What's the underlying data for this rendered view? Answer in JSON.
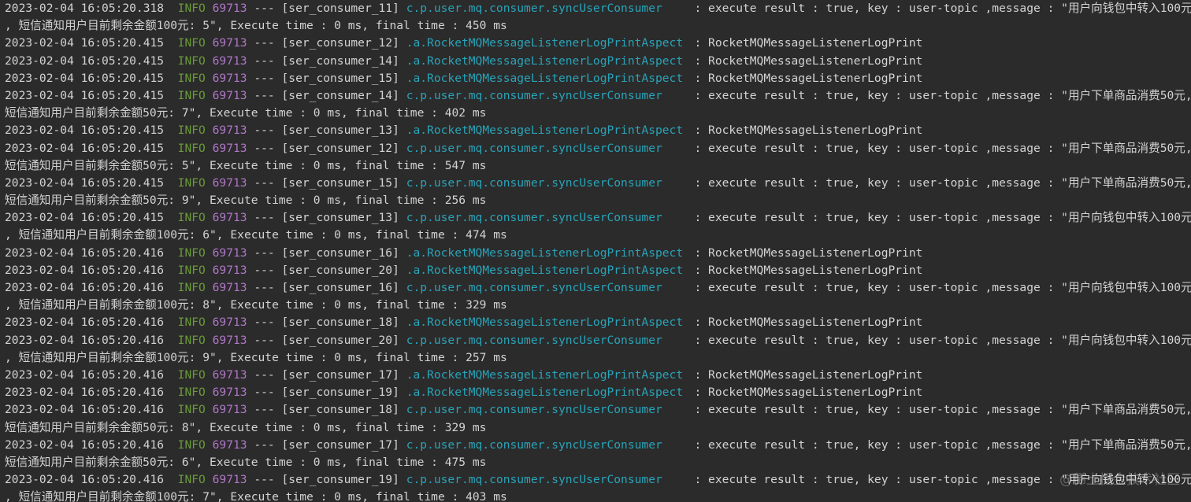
{
  "watermark": "@稀土掘金技术社区",
  "lines": [
    {
      "type": "log",
      "ts": "2023-02-04 16:05:20.318",
      "level": "INFO",
      "pid": "69713",
      "sep": "---",
      "thread": "[ser_consumer_11]",
      "logger": "c.p.user.mq.consumer.syncUserConsumer",
      "message": ": execute result : true, key : user-topic ,message : \"用户向钱包中转入100元"
    },
    {
      "type": "cont",
      "text": ", 短信通知用户目前剩余金额100元: 5\", Execute time : 0 ms, final time : 450 ms"
    },
    {
      "type": "log",
      "ts": "2023-02-04 16:05:20.415",
      "level": "INFO",
      "pid": "69713",
      "sep": "---",
      "thread": "[ser_consumer_12]",
      "logger": ".a.RocketMQMessageListenerLogPrintAspect",
      "message": ": RocketMQMessageListenerLogPrint"
    },
    {
      "type": "log",
      "ts": "2023-02-04 16:05:20.415",
      "level": "INFO",
      "pid": "69713",
      "sep": "---",
      "thread": "[ser_consumer_14]",
      "logger": ".a.RocketMQMessageListenerLogPrintAspect",
      "message": ": RocketMQMessageListenerLogPrint"
    },
    {
      "type": "log",
      "ts": "2023-02-04 16:05:20.415",
      "level": "INFO",
      "pid": "69713",
      "sep": "---",
      "thread": "[ser_consumer_15]",
      "logger": ".a.RocketMQMessageListenerLogPrintAspect",
      "message": ": RocketMQMessageListenerLogPrint"
    },
    {
      "type": "log",
      "ts": "2023-02-04 16:05:20.415",
      "level": "INFO",
      "pid": "69713",
      "sep": "---",
      "thread": "[ser_consumer_14]",
      "logger": "c.p.user.mq.consumer.syncUserConsumer",
      "message": ": execute result : true, key : user-topic ,message : \"用户下单商品消费50元,"
    },
    {
      "type": "cont",
      "text": "短信通知用户目前剩余金额50元: 7\", Execute time : 0 ms, final time : 402 ms"
    },
    {
      "type": "log",
      "ts": "2023-02-04 16:05:20.415",
      "level": "INFO",
      "pid": "69713",
      "sep": "---",
      "thread": "[ser_consumer_13]",
      "logger": ".a.RocketMQMessageListenerLogPrintAspect",
      "message": ": RocketMQMessageListenerLogPrint"
    },
    {
      "type": "log",
      "ts": "2023-02-04 16:05:20.415",
      "level": "INFO",
      "pid": "69713",
      "sep": "---",
      "thread": "[ser_consumer_12]",
      "logger": "c.p.user.mq.consumer.syncUserConsumer",
      "message": ": execute result : true, key : user-topic ,message : \"用户下单商品消费50元,"
    },
    {
      "type": "cont",
      "text": "短信通知用户目前剩余金额50元: 5\", Execute time : 0 ms, final time : 547 ms"
    },
    {
      "type": "log",
      "ts": "2023-02-04 16:05:20.415",
      "level": "INFO",
      "pid": "69713",
      "sep": "---",
      "thread": "[ser_consumer_15]",
      "logger": "c.p.user.mq.consumer.syncUserConsumer",
      "message": ": execute result : true, key : user-topic ,message : \"用户下单商品消费50元,"
    },
    {
      "type": "cont",
      "text": "短信通知用户目前剩余金额50元: 9\", Execute time : 0 ms, final time : 256 ms"
    },
    {
      "type": "log",
      "ts": "2023-02-04 16:05:20.415",
      "level": "INFO",
      "pid": "69713",
      "sep": "---",
      "thread": "[ser_consumer_13]",
      "logger": "c.p.user.mq.consumer.syncUserConsumer",
      "message": ": execute result : true, key : user-topic ,message : \"用户向钱包中转入100元"
    },
    {
      "type": "cont",
      "text": ", 短信通知用户目前剩余金额100元: 6\", Execute time : 0 ms, final time : 474 ms"
    },
    {
      "type": "log",
      "ts": "2023-02-04 16:05:20.416",
      "level": "INFO",
      "pid": "69713",
      "sep": "---",
      "thread": "[ser_consumer_16]",
      "logger": ".a.RocketMQMessageListenerLogPrintAspect",
      "message": ": RocketMQMessageListenerLogPrint"
    },
    {
      "type": "log",
      "ts": "2023-02-04 16:05:20.416",
      "level": "INFO",
      "pid": "69713",
      "sep": "---",
      "thread": "[ser_consumer_20]",
      "logger": ".a.RocketMQMessageListenerLogPrintAspect",
      "message": ": RocketMQMessageListenerLogPrint"
    },
    {
      "type": "log",
      "ts": "2023-02-04 16:05:20.416",
      "level": "INFO",
      "pid": "69713",
      "sep": "---",
      "thread": "[ser_consumer_16]",
      "logger": "c.p.user.mq.consumer.syncUserConsumer",
      "message": ": execute result : true, key : user-topic ,message : \"用户向钱包中转入100元"
    },
    {
      "type": "cont",
      "text": ", 短信通知用户目前剩余金额100元: 8\", Execute time : 0 ms, final time : 329 ms"
    },
    {
      "type": "log",
      "ts": "2023-02-04 16:05:20.416",
      "level": "INFO",
      "pid": "69713",
      "sep": "---",
      "thread": "[ser_consumer_18]",
      "logger": ".a.RocketMQMessageListenerLogPrintAspect",
      "message": ": RocketMQMessageListenerLogPrint"
    },
    {
      "type": "log",
      "ts": "2023-02-04 16:05:20.416",
      "level": "INFO",
      "pid": "69713",
      "sep": "---",
      "thread": "[ser_consumer_20]",
      "logger": "c.p.user.mq.consumer.syncUserConsumer",
      "message": ": execute result : true, key : user-topic ,message : \"用户向钱包中转入100元"
    },
    {
      "type": "cont",
      "text": ", 短信通知用户目前剩余金额100元: 9\", Execute time : 0 ms, final time : 257 ms"
    },
    {
      "type": "log",
      "ts": "2023-02-04 16:05:20.416",
      "level": "INFO",
      "pid": "69713",
      "sep": "---",
      "thread": "[ser_consumer_17]",
      "logger": ".a.RocketMQMessageListenerLogPrintAspect",
      "message": ": RocketMQMessageListenerLogPrint"
    },
    {
      "type": "log",
      "ts": "2023-02-04 16:05:20.416",
      "level": "INFO",
      "pid": "69713",
      "sep": "---",
      "thread": "[ser_consumer_19]",
      "logger": ".a.RocketMQMessageListenerLogPrintAspect",
      "message": ": RocketMQMessageListenerLogPrint"
    },
    {
      "type": "log",
      "ts": "2023-02-04 16:05:20.416",
      "level": "INFO",
      "pid": "69713",
      "sep": "---",
      "thread": "[ser_consumer_18]",
      "logger": "c.p.user.mq.consumer.syncUserConsumer",
      "message": ": execute result : true, key : user-topic ,message : \"用户下单商品消费50元,"
    },
    {
      "type": "cont",
      "text": "短信通知用户目前剩余金额50元: 8\", Execute time : 0 ms, final time : 329 ms"
    },
    {
      "type": "log",
      "ts": "2023-02-04 16:05:20.416",
      "level": "INFO",
      "pid": "69713",
      "sep": "---",
      "thread": "[ser_consumer_17]",
      "logger": "c.p.user.mq.consumer.syncUserConsumer",
      "message": ": execute result : true, key : user-topic ,message : \"用户下单商品消费50元,"
    },
    {
      "type": "cont",
      "text": "短信通知用户目前剩余金额50元: 6\", Execute time : 0 ms, final time : 475 ms"
    },
    {
      "type": "log",
      "ts": "2023-02-04 16:05:20.416",
      "level": "INFO",
      "pid": "69713",
      "sep": "---",
      "thread": "[ser_consumer_19]",
      "logger": "c.p.user.mq.consumer.syncUserConsumer",
      "message": ": execute result : true, key : user-topic ,message : \"用户向钱包中转入100元"
    },
    {
      "type": "cont",
      "text": ", 短信通知用户目前剩余金额100元: 7\", Execute time : 0 ms, final time : 403 ms"
    }
  ]
}
